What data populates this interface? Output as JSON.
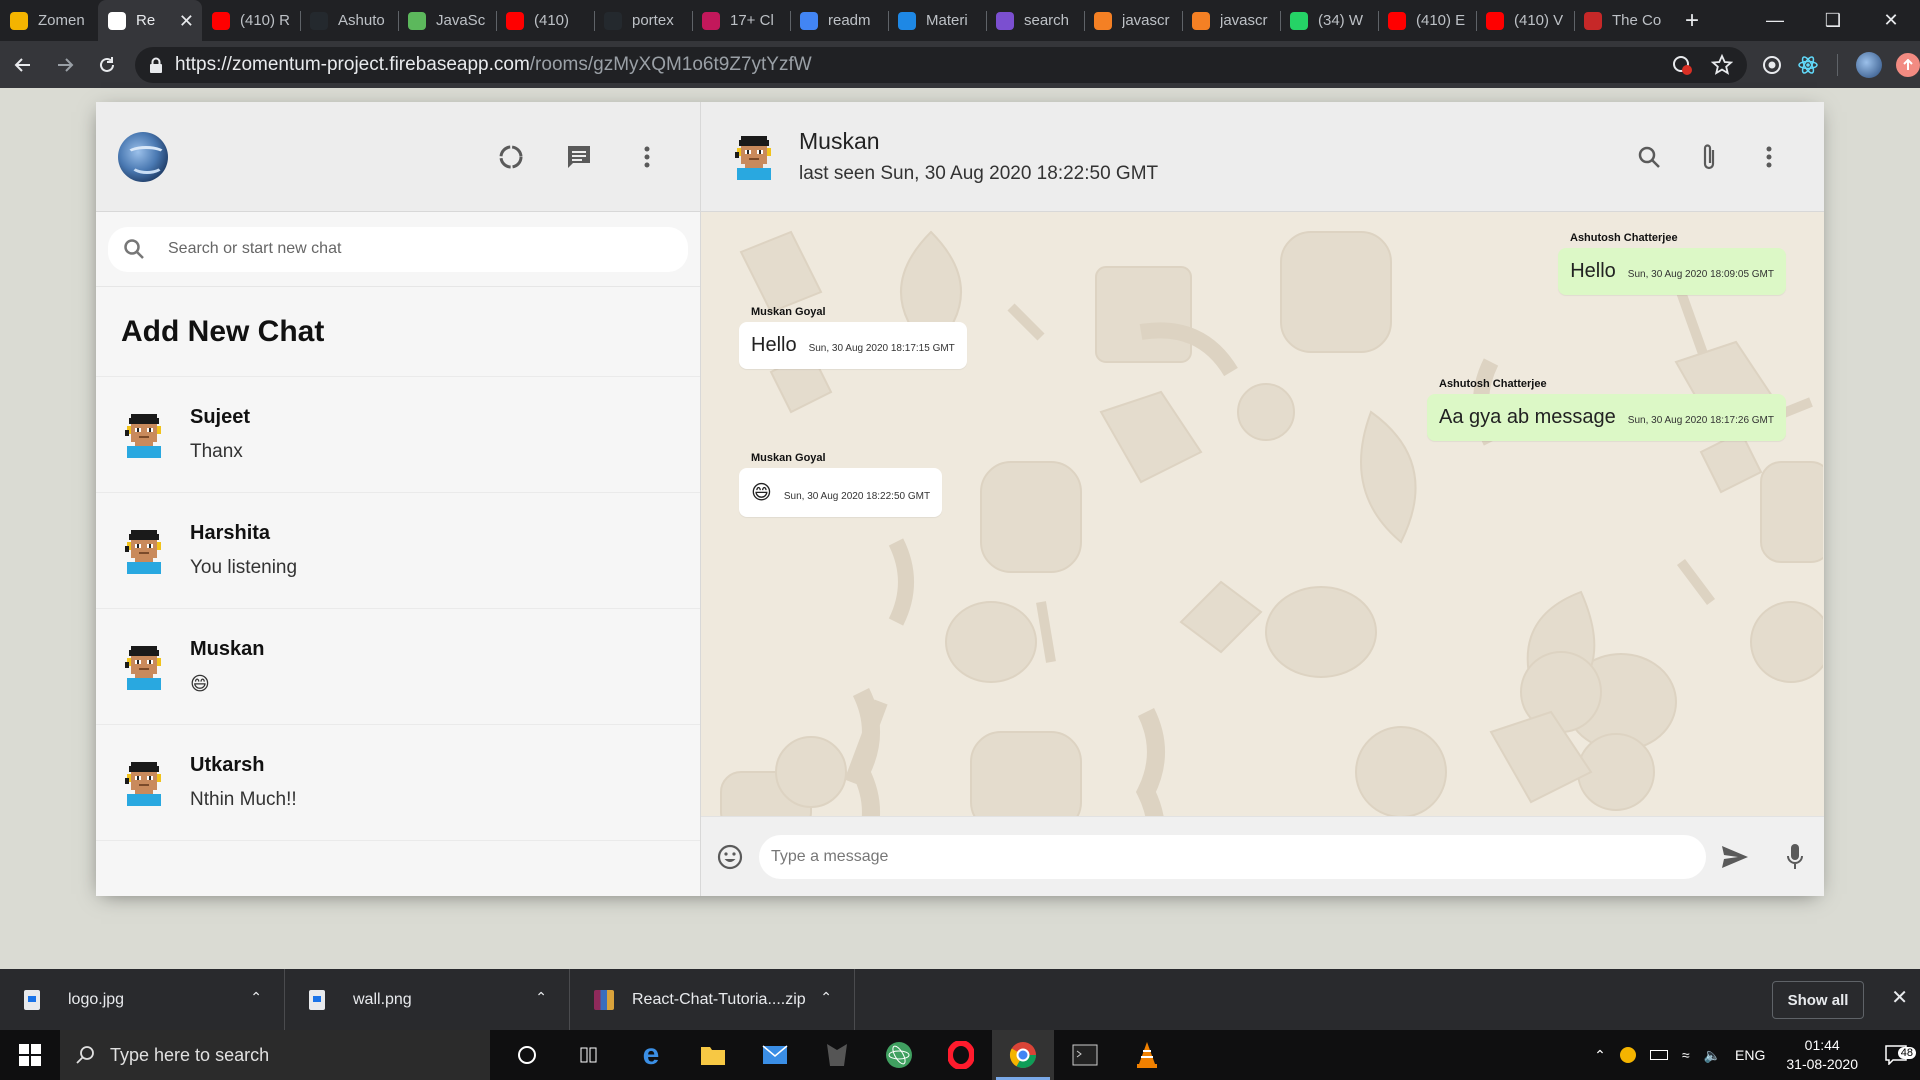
{
  "browser": {
    "tabs": [
      {
        "title": "Zomen",
        "favicon_color": "#f4b400",
        "icon": "flame-icon"
      },
      {
        "title": "Re",
        "favicon_color": "#ffffff",
        "icon": "chrome-globe-icon",
        "active": true
      },
      {
        "title": "(410) R",
        "favicon_color": "#ff0000",
        "icon": "youtube-icon"
      },
      {
        "title": "Ashuto",
        "favicon_color": "#24292e",
        "icon": "github-icon"
      },
      {
        "title": "JavaSc",
        "favicon_color": "#5cb85c",
        "icon": "w3-icon"
      },
      {
        "title": "(410)",
        "favicon_color": "#ff0000",
        "icon": "youtube-icon"
      },
      {
        "title": "portex",
        "favicon_color": "#24292e",
        "icon": "github-icon"
      },
      {
        "title": "17+ Cl",
        "favicon_color": "#c2185b",
        "icon": "site-icon"
      },
      {
        "title": "readm",
        "favicon_color": "#4285f4",
        "icon": "google-icon"
      },
      {
        "title": "Materi",
        "favicon_color": "#1e88e5",
        "icon": "material-icon"
      },
      {
        "title": "search",
        "favicon_color": "#7b4fd0",
        "icon": "bit-icon"
      },
      {
        "title": "javascr",
        "favicon_color": "#f48024",
        "icon": "stackoverflow-icon"
      },
      {
        "title": "javascr",
        "favicon_color": "#f48024",
        "icon": "stackoverflow-icon"
      },
      {
        "title": "(34) W",
        "favicon_color": "#25d366",
        "icon": "whatsapp-icon"
      },
      {
        "title": "(410) E",
        "favicon_color": "#ff0000",
        "icon": "youtube-icon"
      },
      {
        "title": "(410) V",
        "favicon_color": "#ff0000",
        "icon": "youtube-icon"
      },
      {
        "title": "The Co",
        "favicon_color": "#c62828",
        "icon": "udemy-icon"
      }
    ],
    "url_host": "https://zomentum-project.firebaseapp.com",
    "url_path": "/rooms/gzMyXQM1o6t9Z7ytYzfW"
  },
  "sidebar": {
    "search_placeholder": "Search or start new chat",
    "add_new_chat": "Add New Chat",
    "chats": [
      {
        "name": "Sujeet",
        "last": "Thanx"
      },
      {
        "name": "Harshita",
        "last": "You listening"
      },
      {
        "name": "Muskan",
        "last": "😄"
      },
      {
        "name": "Utkarsh",
        "last": "Nthin Much!!"
      }
    ]
  },
  "chat": {
    "name": "Muskan",
    "last_seen": "last seen Sun, 30 Aug 2020 18:22:50 GMT",
    "messages": [
      {
        "sender": "Ashutosh Chatterjee",
        "text": "Hello",
        "time": "Sun, 30 Aug 2020 18:09:05 GMT",
        "type": "sent"
      },
      {
        "sender": "Muskan Goyal",
        "text": "Hello",
        "time": "Sun, 30 Aug 2020 18:17:15 GMT",
        "type": "recv"
      },
      {
        "sender": "Ashutosh Chatterjee",
        "text": "Aa gya ab message",
        "time": "Sun, 30 Aug 2020 18:17:26 GMT",
        "type": "sent"
      },
      {
        "sender": "Muskan Goyal",
        "text": "😄",
        "time": "Sun, 30 Aug 2020 18:22:50 GMT",
        "type": "recv"
      }
    ],
    "input_placeholder": "Type a message"
  },
  "downloads": {
    "items": [
      "logo.jpg",
      "wall.png",
      "React-Chat-Tutoria....zip"
    ],
    "show_all": "Show all"
  },
  "taskbar": {
    "search_placeholder": "Type here to search",
    "language": "ENG",
    "time": "01:44",
    "date": "31-08-2020",
    "notification_count": "48"
  }
}
